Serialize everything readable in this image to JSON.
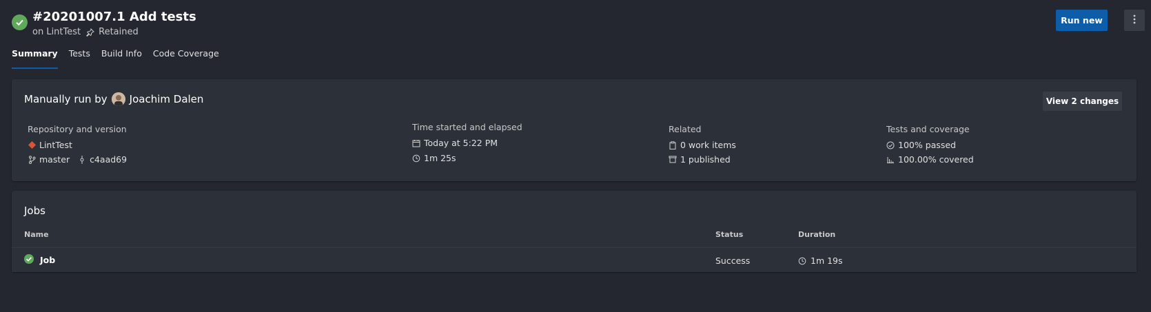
{
  "header": {
    "title": "#20201007.1 Add tests",
    "subtitle_prefix": "on LintTest",
    "retained_label": "Retained",
    "run_new_label": "Run new"
  },
  "tabs": [
    {
      "label": "Summary",
      "active": true
    },
    {
      "label": "Tests",
      "active": false
    },
    {
      "label": "Build Info",
      "active": false
    },
    {
      "label": "Code Coverage",
      "active": false
    }
  ],
  "run": {
    "title_prefix": "Manually run by",
    "user_name": "Joachim Dalen",
    "view_changes_label": "View 2 changes",
    "repository": {
      "label": "Repository and version",
      "repo": "LintTest",
      "branch": "master",
      "commit": "c4aad69"
    },
    "time": {
      "label": "Time started and elapsed",
      "started": "Today at 5:22 PM",
      "elapsed": "1m 25s"
    },
    "related": {
      "label": "Related",
      "work_items": "0 work items",
      "published": "1 published"
    },
    "tests": {
      "label": "Tests and coverage",
      "passed": "100% passed",
      "covered": "100.00% covered"
    }
  },
  "jobs": {
    "title": "Jobs",
    "columns": {
      "name": "Name",
      "status": "Status",
      "duration": "Duration"
    },
    "rows": [
      {
        "name": "Job",
        "status": "Success",
        "duration": "1m 19s"
      }
    ]
  },
  "colors": {
    "success": "#5fa85c",
    "primary": "#0e5da8",
    "repo_icon": "#e0532e"
  }
}
